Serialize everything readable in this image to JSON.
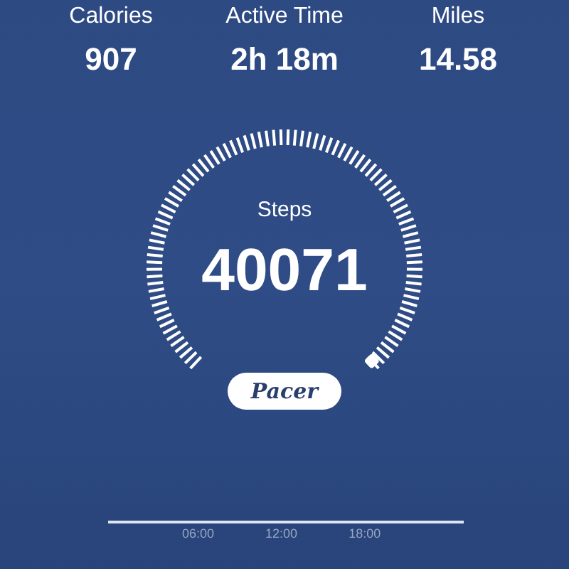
{
  "stats": [
    {
      "label": "Calories",
      "value": "907"
    },
    {
      "label": "Active Time",
      "value": "2h 18m"
    },
    {
      "label": "Miles",
      "value": "14.58"
    }
  ],
  "gauge": {
    "label": "Steps",
    "value": "40071"
  },
  "logo": "Pacer",
  "timeline": {
    "labels": [
      "06:00",
      "12:00",
      "18:00"
    ]
  }
}
